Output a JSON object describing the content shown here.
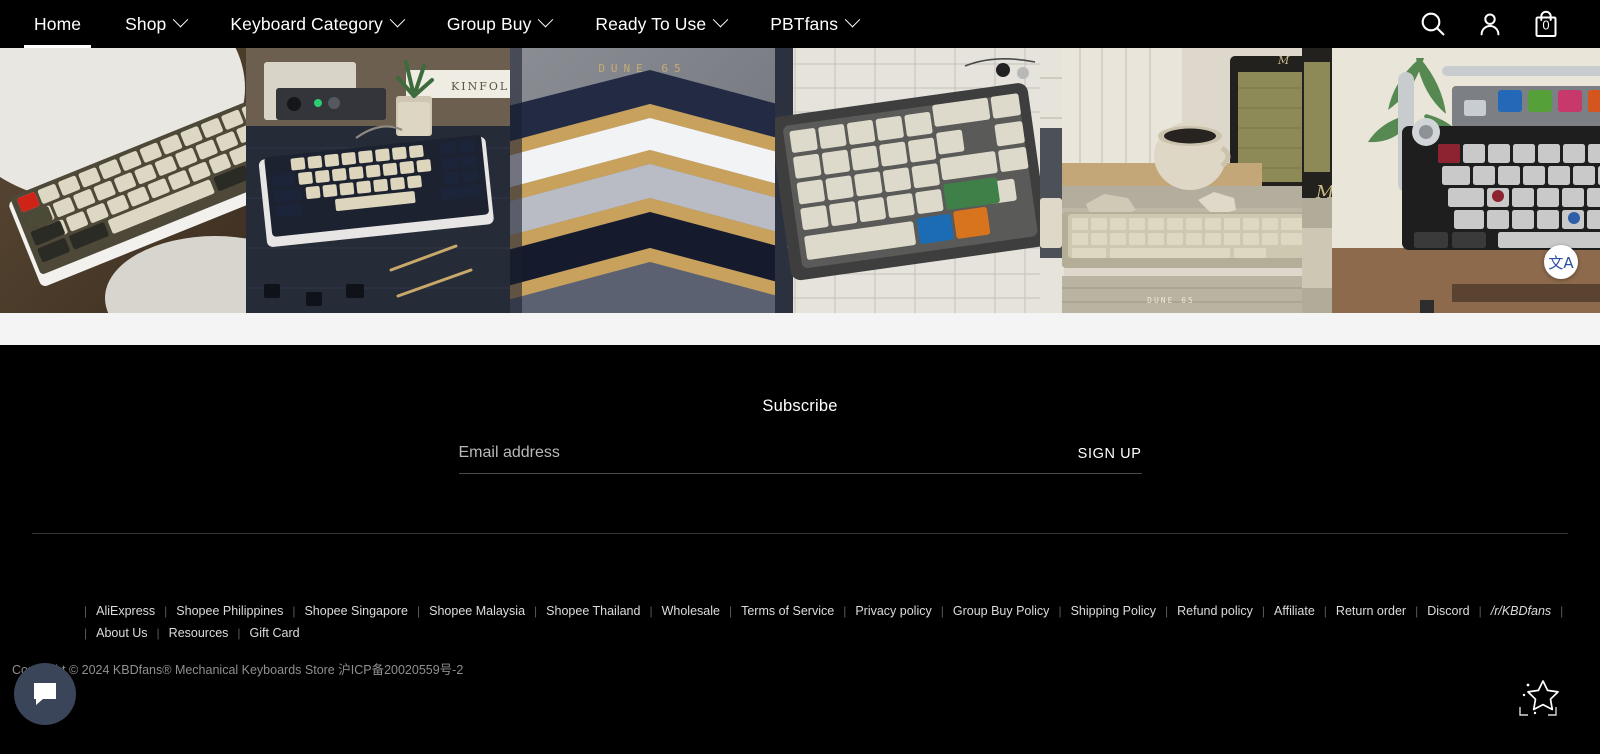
{
  "nav": {
    "items": [
      {
        "label": "Home",
        "has_dropdown": false,
        "active": true
      },
      {
        "label": "Shop",
        "has_dropdown": true,
        "active": false
      },
      {
        "label": "Keyboard Category",
        "has_dropdown": true,
        "active": false
      },
      {
        "label": "Group Buy",
        "has_dropdown": true,
        "active": false
      },
      {
        "label": "Ready To Use",
        "has_dropdown": true,
        "active": false
      },
      {
        "label": "PBTfans",
        "has_dropdown": true,
        "active": false
      }
    ],
    "search_icon": "search-icon",
    "account_icon": "account-icon",
    "cart_icon": "shopping-bag-icon",
    "cart_count": "0"
  },
  "gallery": {
    "tiles": [
      {
        "alt": "Cream and dark mechanical keyboard with red escape key on white desk",
        "caption": ""
      },
      {
        "alt": "Desk setup with cream and navy keyboard, plant, audio interface and Kinfolk book",
        "caption": ""
      },
      {
        "alt": "Stacked keyboard cases in navy, white and grey with gold accents",
        "caption": "DUNE 65"
      },
      {
        "alt": "Retro beige keyboard with green, blue and orange accent keycaps on grid paper",
        "caption": ""
      },
      {
        "alt": "Cozy desk with coffee cup, speaker and vintage keyboard",
        "caption": "DUNE 65"
      },
      {
        "alt": "Typewriter style keyboard with colorful macro keys and plant",
        "caption": ""
      }
    ],
    "translate_label": "文A"
  },
  "footer": {
    "subscribe_title": "Subscribe",
    "email_placeholder": "Email address",
    "email_value": "",
    "signup_label": "SIGN UP",
    "links_row_1": [
      "AliExpress",
      "Shopee Philippines",
      "Shopee Singapore",
      "Shopee Malaysia",
      "Shopee Thailand",
      "Wholesale",
      "Terms of Service",
      "Privacy policy",
      "Group Buy Policy",
      "Shipping Policy",
      "Refund policy",
      "Affiliate",
      "Return order",
      "Discord",
      "/r/KBDfans"
    ],
    "links_row_2": [
      "About Us",
      "Resources",
      "Gift Card"
    ],
    "copyright": "Copyright © 2024 KBDfans® Mechanical Keyboards Store 沪ICP备20020559号-2",
    "chat_icon": "chat-bubble-icon",
    "star_icon": "sparkle-star-icon"
  },
  "colors": {
    "background": "#000000",
    "band": "#f4f4f4",
    "accent_gold": "#c6ac74",
    "chat_bg": "#3b4559",
    "translate_fg": "#2d4fa0"
  }
}
